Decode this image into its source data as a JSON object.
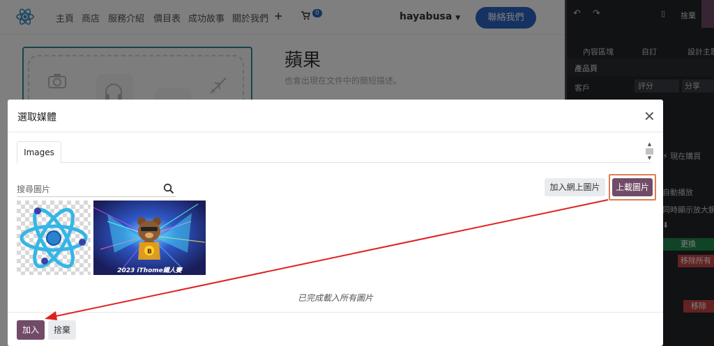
{
  "website": {
    "nav": [
      "主頁",
      "商店",
      "服務介紹",
      "價目表",
      "成功故事",
      "關於我們"
    ],
    "nav_add_icon": "plus-icon",
    "cart_icon": "shopping-cart-icon",
    "cart_count": "0",
    "user": "hayabusa",
    "contact_button": "聯絡我們",
    "product_title": "蘋果",
    "product_desc": "也會出現在文件中的簡短描述。"
  },
  "editor_panel": {
    "undo_icon": "undo-icon",
    "redo_icon": "redo-icon",
    "mobile_icon": "mobile-icon",
    "discard": "捨棄",
    "tabs": [
      "內容區塊",
      "自訂",
      "設計主題"
    ],
    "section": "產品頁",
    "customer_label": "客戶",
    "options": [
      "評分",
      "分享"
    ],
    "buy_now": "現在購買",
    "autoplay": "自動播放",
    "zoom": "同時顯示放大鏡",
    "replace": "更換",
    "remove_all": "移除所有",
    "remove": "移除"
  },
  "modal": {
    "title": "選取媒體",
    "tab": "Images",
    "search_placeholder": "搜尋圖片",
    "add_url_button": "加入網上圖片",
    "upload_button": "上載圖片",
    "images": [
      {
        "name": "react-logo",
        "caption": ""
      },
      {
        "name": "ithome-bear",
        "caption": "2023 iThome鐵人賽"
      }
    ],
    "status": "已完成載入所有圖片",
    "add_button": "加入",
    "discard_button": "捨棄"
  },
  "colors": {
    "primary_purple": "#714b67",
    "website_blue": "#2b64c5",
    "highlight_orange": "#e07b4f",
    "arrow_red": "#e02020"
  }
}
